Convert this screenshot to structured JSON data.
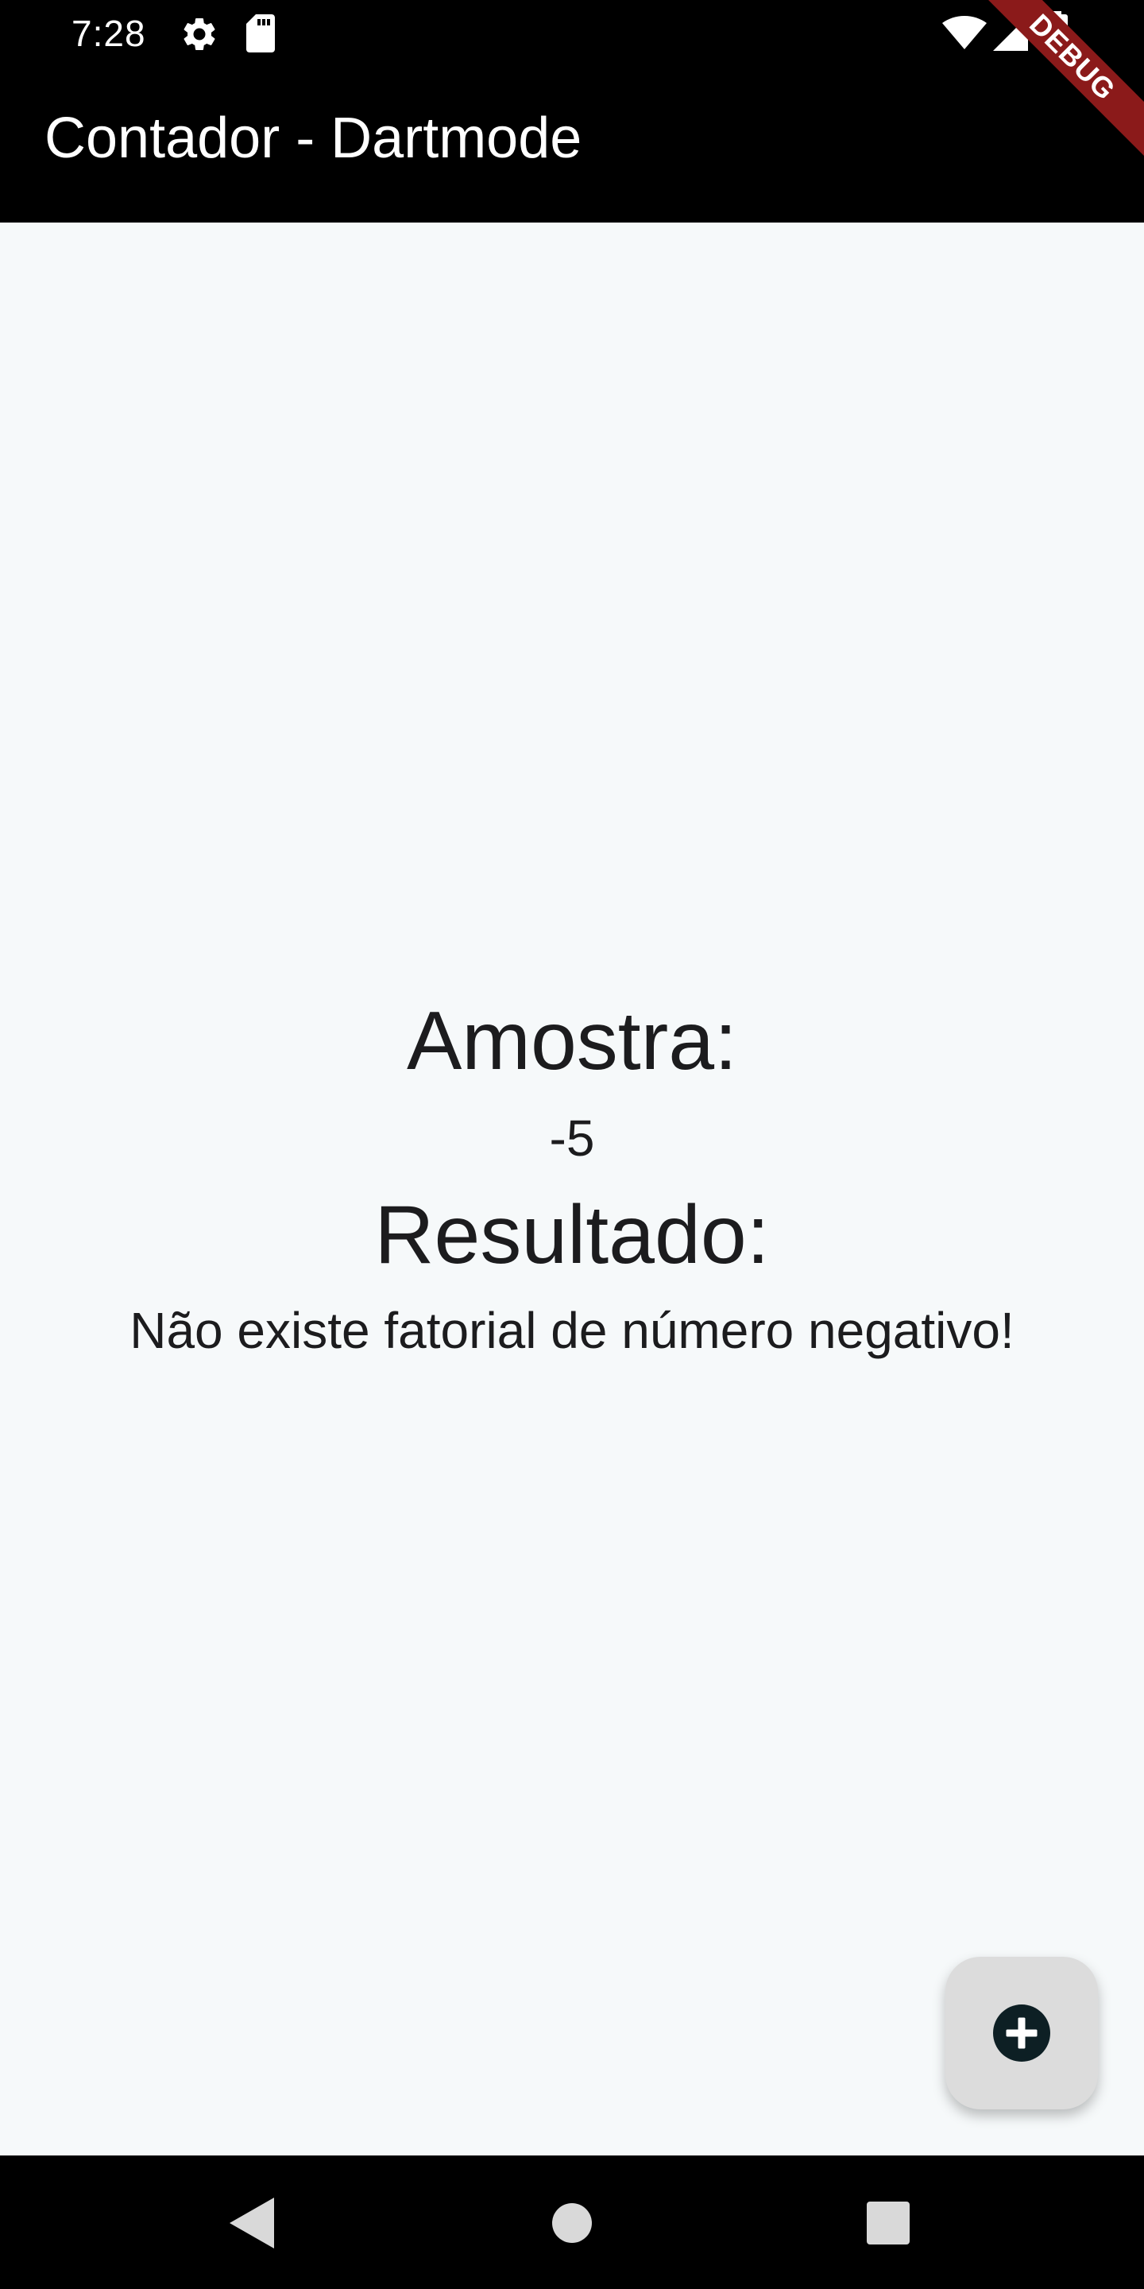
{
  "status_bar": {
    "time": "7:28",
    "icons": [
      "gear-icon",
      "sd-card-icon",
      "wifi-icon",
      "signal-icon",
      "battery-icon"
    ]
  },
  "app_bar": {
    "title": "Contador - Dartmode",
    "debug_banner": "DEBUG",
    "background_color": "#000000"
  },
  "main": {
    "sample_label": "Amostra:",
    "sample_value": "-5",
    "result_label": "Resultado:",
    "result_value": "Não existe fatorial de número negativo!",
    "background_color": "#f6f9fa"
  },
  "fab": {
    "icon": "add-circle-icon",
    "background_color": "#dcdcdc"
  },
  "nav_bar": {
    "buttons": [
      "back-icon",
      "home-icon",
      "recents-icon"
    ]
  }
}
